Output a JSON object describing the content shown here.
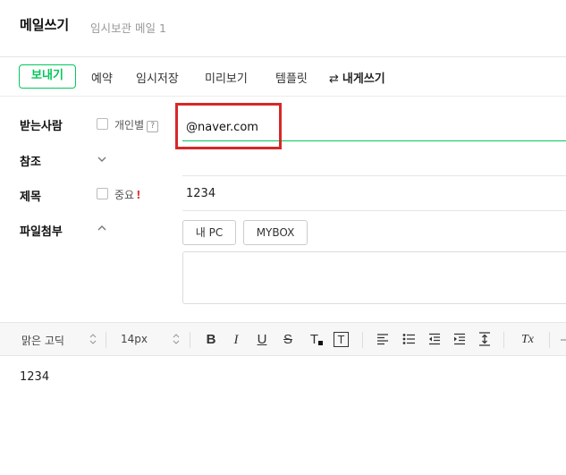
{
  "header": {
    "title": "메일쓰기",
    "draft_label": "임시보관 메일 1"
  },
  "toolbar": {
    "send": "보내기",
    "reserve": "예약",
    "save_draft": "임시저장",
    "preview": "미리보기",
    "template": "템플릿",
    "to_me_arrows": "⇄",
    "to_me": "내게쓰기"
  },
  "recipient": {
    "label": "받는사람",
    "individual_label": "개인별",
    "help": "?",
    "value": "@naver.com"
  },
  "cc": {
    "label": "참조"
  },
  "subject": {
    "label": "제목",
    "important_label": "중요",
    "important_mark": "!",
    "value": "1234"
  },
  "attachment": {
    "label": "파일첨부",
    "my_pc": "내 PC",
    "mybox": "MYBOX"
  },
  "editor": {
    "font": "맑은 고딕",
    "size": "14px",
    "bold": "B",
    "italic": "I",
    "underline": "U",
    "strike": "S",
    "text_color": "T",
    "text_bg": "T",
    "clear_format": "Tx",
    "body": "1234"
  }
}
